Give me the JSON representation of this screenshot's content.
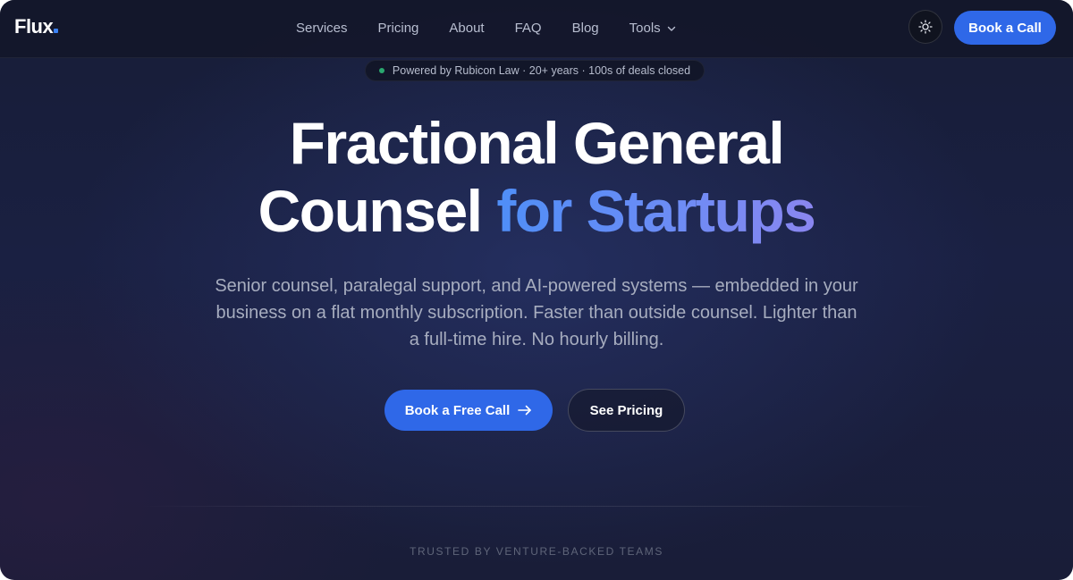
{
  "header": {
    "logo": "Flux",
    "nav": [
      {
        "label": "Services"
      },
      {
        "label": "Pricing"
      },
      {
        "label": "About"
      },
      {
        "label": "FAQ"
      },
      {
        "label": "Blog"
      },
      {
        "label": "Tools"
      }
    ],
    "theme_icon": "sun-icon",
    "cta_label": "Book a Call"
  },
  "badge": {
    "text": "Powered by Rubicon Law · 20+ years · 100s of deals closed",
    "dot_color": "#2aa86f"
  },
  "hero": {
    "title_line1": "Fractional General",
    "title_line2_plain": "Counsel ",
    "title_line2_accent": "for Startups",
    "subtitle": "Senior counsel, paralegal support, and AI-powered systems — embedded in your business on a flat monthly subscription. Faster than outside counsel. Lighter than a full-time hire. No hourly billing.",
    "primary_cta": "Book a Free Call",
    "secondary_cta": "See Pricing"
  },
  "trusted": {
    "label": "TRUSTED BY VENTURE-BACKED TEAMS"
  },
  "colors": {
    "accent": "#2f68e8",
    "background": "#1a2042",
    "gradient_start": "#4f8ef7",
    "gradient_end": "#8a86f0"
  }
}
